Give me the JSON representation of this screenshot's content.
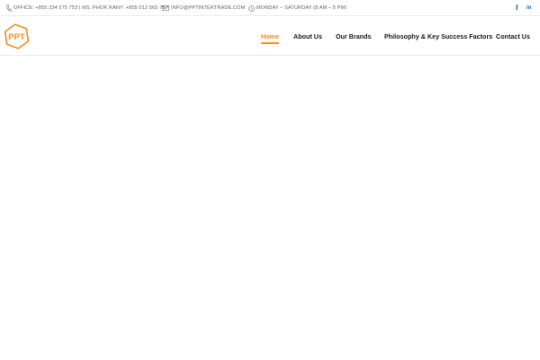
{
  "topbar": {
    "phone": "OFFICE: +855 234 575 753 | MS. PHOK RANY: +855 012 565 767",
    "email": "INFO@PPTINTERTRADE.COM",
    "hours": "MONDAY – SATURDAY (8 AM – 5 PM)",
    "social": {
      "facebook": "f",
      "linkedin": "in"
    }
  },
  "logo": {
    "text": "PPT"
  },
  "nav": {
    "items": [
      {
        "label": "Home"
      },
      {
        "label": "About Us"
      },
      {
        "label": "Our Brands"
      },
      {
        "label": "Philosophy & Key Success Factors"
      },
      {
        "label": "Contact Us"
      }
    ],
    "active": "Home"
  },
  "colors": {
    "accent": "#f4912c",
    "facebook": "#3b5998",
    "linkedin": "#0a66c2"
  },
  "icons": [
    "phone-icon",
    "email-icon",
    "clock-icon",
    "facebook-icon",
    "linkedin-icon"
  ]
}
